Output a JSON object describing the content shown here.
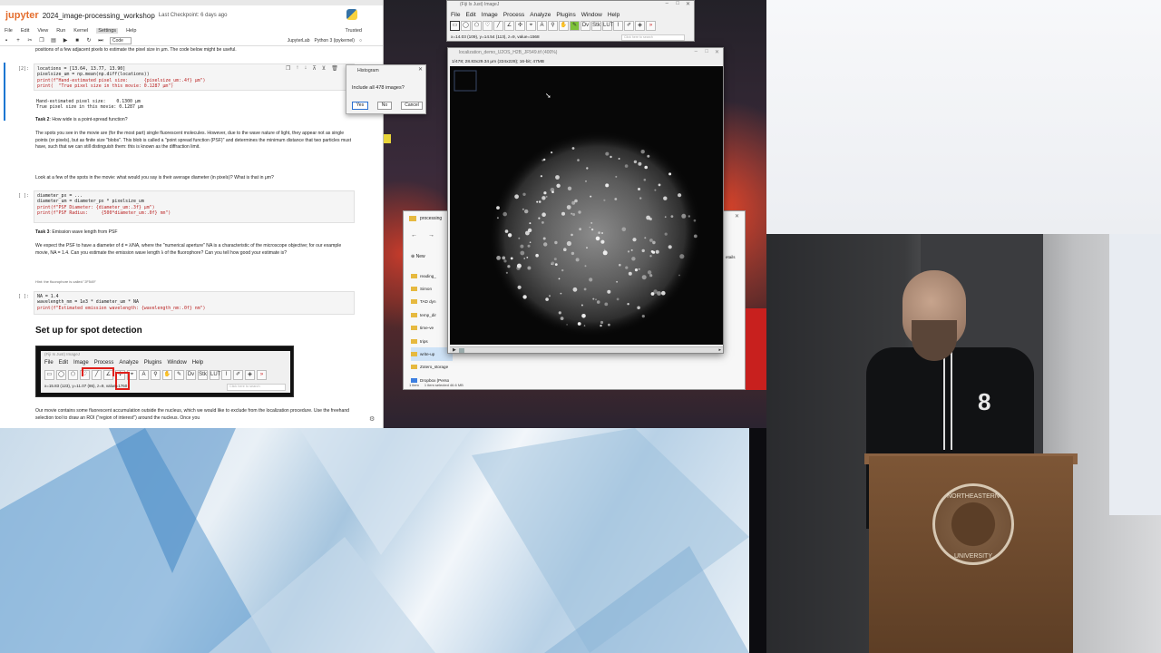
{
  "jupyter": {
    "logo": "jupyter",
    "notebook_name": "2024_image-processing_workshop",
    "checkpoint": "Last Checkpoint: 6 days ago",
    "menu": [
      "File",
      "Edit",
      "View",
      "Run",
      "Kernel",
      "Settings",
      "Help"
    ],
    "active_menu": "Settings",
    "trusted": "Trusted",
    "cell_type": "Code",
    "jupyterlab_link": "JupyterLab",
    "kernel": "Python 3 (ipykernel)",
    "intro_text": "positions of a few adjacent pixels to estimate the pixel size in μm. The code below might be useful.",
    "cell1_prompt": "[2]:",
    "cell1_code": [
      "locations = [13.64, 13.77, 13.90]",
      "pixelsize_um = np.mean(np.diff(locations))",
      "print(f\"Hand-estimated pixel size:      {pixelsize_um:.4f} μm\")",
      "print(  \"True pixel size in this movie: 0.1287 μm\")"
    ],
    "cell1_output": [
      "Hand-estimated pixel size:    0.1300 μm",
      "True pixel size in this movie: 0.1287 μm"
    ],
    "task2_title": "Task 2",
    "task2_heading": ": How wide is a point-spread function?",
    "task2_p1": "The spots you see in the movie are (for the most part) single fluorescent molecules. However, due to the wave nature of light, they appear not as single points (or pixels), but as finite size \"blobs\". This blob is called a \"point spread function (PSF)\" and determines the minimum distance that two particles must have, such that we can still distinguish them: this is known as the diffraction limit.",
    "task2_p2": "Look at a few of the spots in the movie: what would you say is their average diameter (in pixels)? What is that in μm?",
    "cell2_prompt": "[ ]:",
    "cell2_code": [
      "diameter_px = ...",
      "diameter_um = diameter_px * pixelsize_um",
      "print(f\"PSF Diameter: {diameter_um:.3f} μm\")",
      "print(f\"PSF Radius:     {500*diameter_um:.0f} nm\")"
    ],
    "task3_title": "Task 3",
    "task3_heading": ": Emission wave length from PSF",
    "task3_p1": "We expect the PSF to have a diameter of d = λ/NA, where the \"numerical aperture\" NA is a characteristic of the microscope objective; for our example movie, NA = 1.4. Can you estimate the emission wave length λ of the fluorophore? Can you tell how good your estimate is?",
    "hint": "Hint: the fluorophore is called \"JF549\"",
    "cell3_prompt": "[ ]:",
    "cell3_code": [
      "NA = 1.4",
      "wavelength_nm = 1e3 * diameter_um * NA",
      "print(f\"Estimated emission wavelength: {wavelength_nm:.0f} nm\")"
    ],
    "section_heading": "Set up for spot detection",
    "outro_text": "Our movie contains some fluorescent accumulation outside the nucleus, which we would like to exclude from the localization procedure. Use the freehand selection tool to draw an ROI (\"region of interest\") around the nucleus. Once you"
  },
  "embedded_fiji": {
    "title": "(Fiji Is Just) ImageJ",
    "menu": [
      "File",
      "Edit",
      "Image",
      "Process",
      "Analyze",
      "Plugins",
      "Window",
      "Help"
    ],
    "status": "x=15.83 (123), y=11.07 (86), z=9, value=1760",
    "search": "Click here to search"
  },
  "histogram_dialog": {
    "title": "Histogram",
    "question": "Include all 478 images?",
    "yes": "Yes",
    "no": "No",
    "cancel": "Cancel"
  },
  "fiji": {
    "title": "(Fiji Is Just) ImageJ",
    "menu": [
      "File",
      "Edit",
      "Image",
      "Process",
      "Analyze",
      "Plugins",
      "Window",
      "Help"
    ],
    "status": "x=14.03 (109), y=14.54 (113), z=9, value=1568",
    "search": "Click here to search"
  },
  "image_window": {
    "title": "localization_demo_U2OS_H2B_JF549.tif (400%)",
    "info": "1/478; 28.83x29.34 μm (224x228); 16-bit; 47MB"
  },
  "explorer": {
    "title": "processing",
    "new_label": "New",
    "tree": [
      "reading_",
      "Simon",
      "TAD dyn",
      "temp_dir",
      "time-ve",
      "trips",
      "write-up",
      "Zotero_storage",
      "Dropbox (Perso"
    ],
    "status_items": "1 item",
    "status_selected": "1 item selected  46.6 MB",
    "details_label": "etails"
  },
  "speaker": {
    "shirt_number": "8",
    "seal_top": "NORTHEASTERN",
    "seal_bottom": "UNIVERSITY"
  }
}
